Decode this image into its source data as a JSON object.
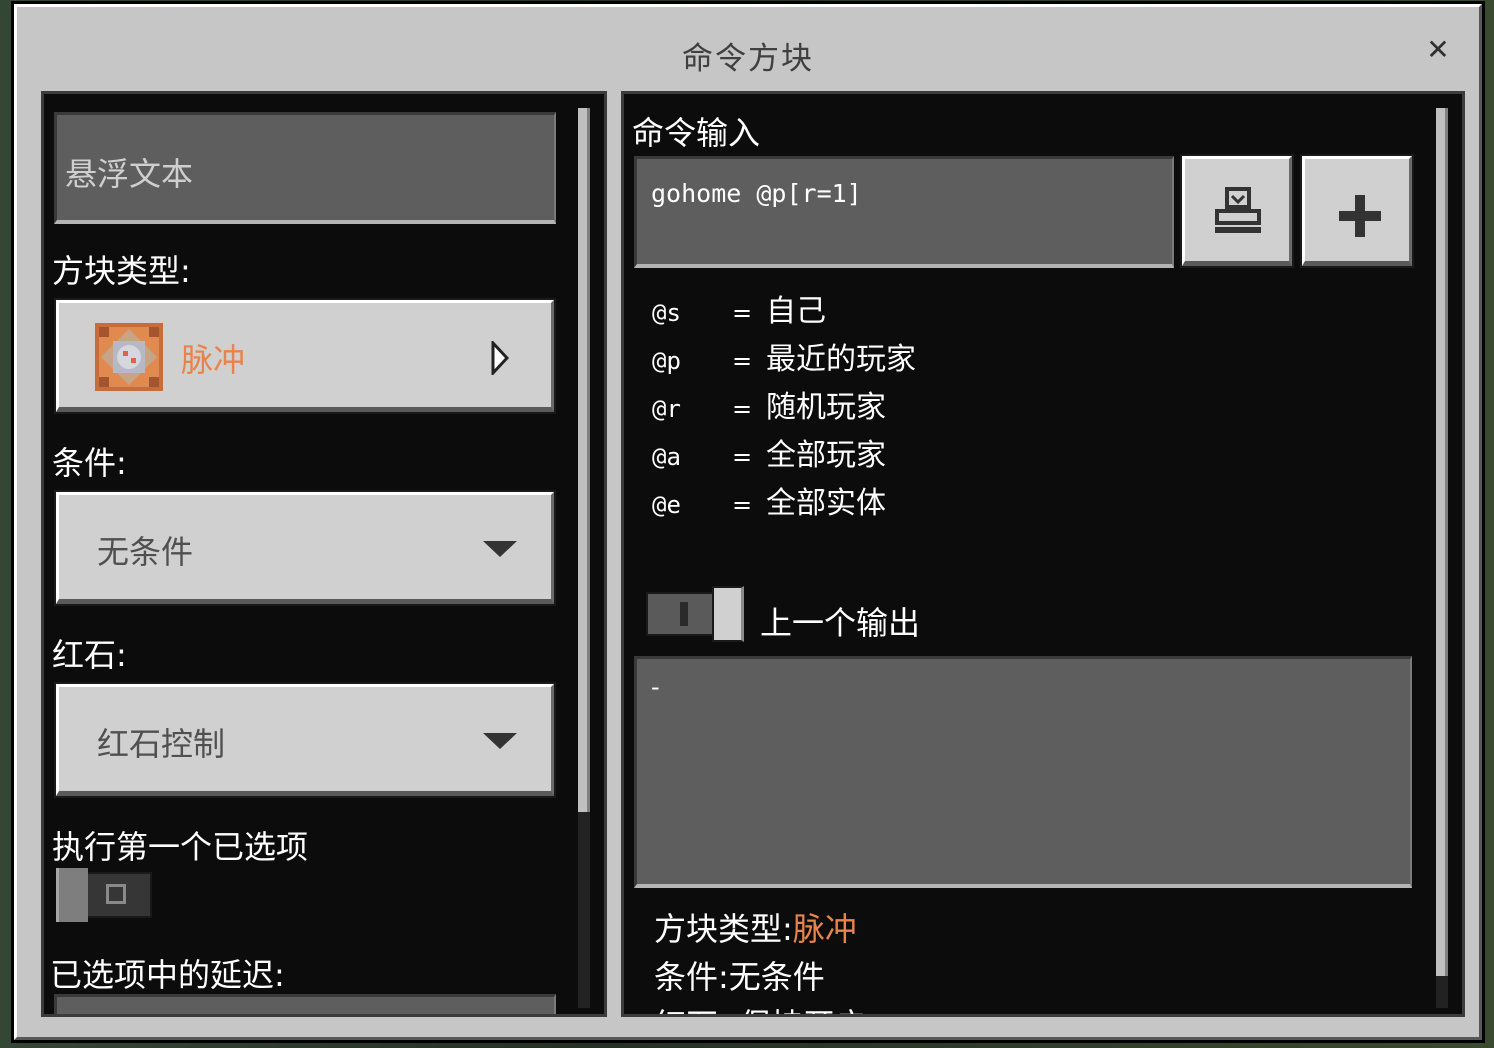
{
  "window": {
    "title": "命令方块"
  },
  "left": {
    "hover_text_placeholder": "悬浮文本",
    "block_type_label": "方块类型:",
    "block_type_value": "脉冲",
    "condition_label": "条件:",
    "condition_value": "无条件",
    "redstone_label": "红石:",
    "redstone_value": "红石控制",
    "execute_first_label": "执行第一个已选项",
    "delay_label": "已选项中的延迟:"
  },
  "right": {
    "command_input_label": "命令输入",
    "command_value": "gohome @p[r=1]",
    "selectors": [
      {
        "code": "@s",
        "eq": "=",
        "desc": "自己"
      },
      {
        "code": "@p",
        "eq": "=",
        "desc": "最近的玩家"
      },
      {
        "code": "@r",
        "eq": "=",
        "desc": "随机玩家"
      },
      {
        "code": "@a",
        "eq": "=",
        "desc": "全部玩家"
      },
      {
        "code": "@e",
        "eq": "=",
        "desc": "全部实体"
      }
    ],
    "previous_output_label": "上一个输出",
    "previous_output_value": "-",
    "summary": {
      "block_type_label": "方块类型:",
      "block_type_value": "脉冲",
      "condition_label": "条件:",
      "condition_value": "无条件",
      "redstone_partial": "红石: 保持开启"
    }
  },
  "colors": {
    "accent_orange": "#e8844a",
    "panel_bg": "#0c0c0c",
    "window_bg": "#c6c6c6"
  },
  "icons": [
    "close-icon",
    "impulse-command-block-icon",
    "chevron-right-icon",
    "dropdown-arrow-icon",
    "stamp-icon",
    "plus-icon",
    "toggle-icon"
  ]
}
